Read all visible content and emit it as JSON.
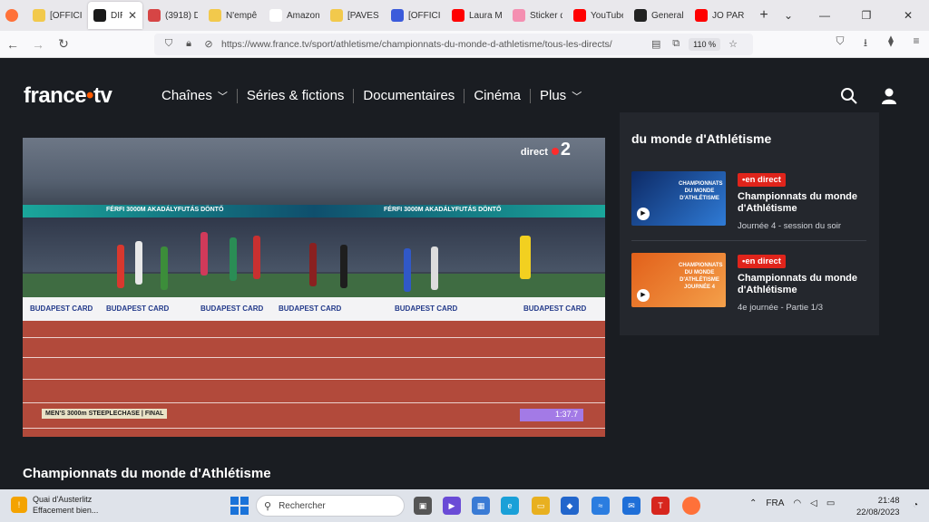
{
  "browser": {
    "tabs": [
      {
        "label": "[OFFICIE",
        "icon": "emoji-icon",
        "color": "#f2c94c"
      },
      {
        "label": "DIREC LECTU",
        "icon": "francetv-icon",
        "color": "#1a1a1a",
        "active": true
      },
      {
        "label": "(3918) D",
        "icon": "badge-icon",
        "color": "#d64545"
      },
      {
        "label": "N'empê",
        "icon": "emoji-icon",
        "color": "#f2c94c"
      },
      {
        "label": "Amazon",
        "icon": "amazon-icon",
        "color": "#ffffff"
      },
      {
        "label": "[PAVES H",
        "icon": "emoji-icon",
        "color": "#f2c94c"
      },
      {
        "label": "[OFFICIE",
        "icon": "j-icon",
        "color": "#3b5bdb"
      },
      {
        "label": "Laura M",
        "icon": "youtube-icon",
        "color": "#ff0000"
      },
      {
        "label": "Sticker d",
        "icon": "sticker-icon",
        "color": "#f48fb1"
      },
      {
        "label": "YouTube",
        "icon": "youtube-icon",
        "color": "#ff0000"
      },
      {
        "label": "General",
        "icon": "github-icon",
        "color": "#222222"
      },
      {
        "label": "JO PARIS",
        "icon": "youtube-icon",
        "color": "#ff0000"
      }
    ],
    "new_tab": "+",
    "list_tabs": "⌄",
    "url": "https://www.france.tv/sport/athletisme/championnats-du-monde-d-athletisme/tous-les-directs/",
    "zoom": "110 %"
  },
  "site": {
    "logo_text_a": "france",
    "logo_dot": "•",
    "logo_text_b": "tv",
    "menu": [
      "Chaînes",
      "Séries & fictions",
      "Documentaires",
      "Cinéma",
      "Plus"
    ]
  },
  "player": {
    "channel": "direct",
    "channel_num": "2",
    "banner_text": "FÉRFI 3000M AKADÁLYFUTÁS DÖNTŐ",
    "ad_text": "BUDAPEST CARD",
    "caption": "MEN'S 3000m STEEPLECHASE | FINAL",
    "clock": "1:37.7"
  },
  "panel": {
    "title": "du monde d'Athlétisme",
    "cards": [
      {
        "badge": "•en direct",
        "title": "Championnats du monde d'Athlétisme",
        "sub": "Journée 4 - session du soir",
        "thumb_color": "#1b4fa6",
        "thumb_label": "CHAMPIONNATS DU MONDE D'ATHLÉTISME"
      },
      {
        "badge": "•en direct",
        "title": "Championnats du monde d'Athlétisme",
        "sub": "4e journée - Partie 1/3",
        "thumb_color": "#f07a1a",
        "thumb_label": "CHAMPIONNATS DU MONDE D'ATHLÉTISME JOURNÉE 4"
      }
    ]
  },
  "section_title": "Championnats du monde d'Athlétisme",
  "taskbar": {
    "weather_title": "Quai d'Austerlitz",
    "weather_sub": "Effacement bien...",
    "search_placeholder": "Rechercher",
    "lang": "FRA",
    "time": "21:48",
    "date": "22/08/2023"
  }
}
